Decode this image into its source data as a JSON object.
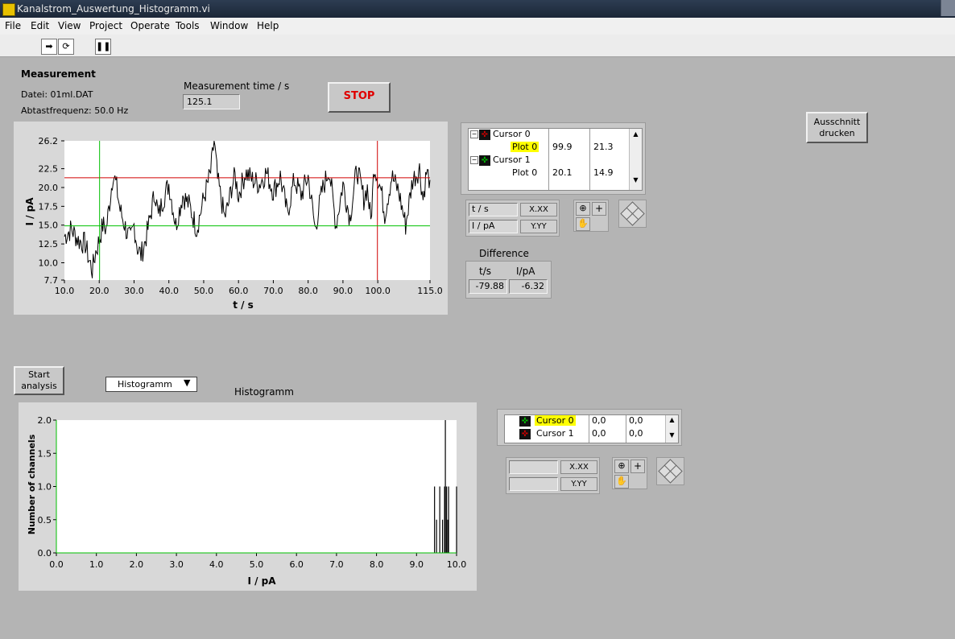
{
  "window": {
    "title": "Kanalstrom_Auswertung_Histogramm.vi"
  },
  "menu": [
    "File",
    "Edit",
    "View",
    "Project",
    "Operate",
    "Tools",
    "Window",
    "Help"
  ],
  "measurement": {
    "title": "Measurement",
    "file": "Datei: 01ml.DAT",
    "rate": "Abtastfrequenz: 50.0 Hz",
    "time_label": "Measurement time / s",
    "time_value": "125.1",
    "stop_label": "STOP"
  },
  "print_button": "Ausschnitt\ndrucken",
  "cursor_legend_top": {
    "rows": [
      {
        "name": "Cursor 0",
        "plot": "Plot 0",
        "x": "99.9",
        "y": "21.3",
        "color": "#d00000"
      },
      {
        "name": "Cursor 1",
        "plot": "Plot 0",
        "x": "20.1",
        "y": "14.9",
        "color": "#00a000"
      }
    ],
    "x_axis_label": "t / s",
    "y_axis_label": "I / pA",
    "x_format": "X.XX",
    "y_format": "Y.YY"
  },
  "difference": {
    "title": "Difference",
    "col_t": "t/s",
    "col_i": "I/pA",
    "t_value": "-79.88",
    "i_value": "-6.32"
  },
  "analysis": {
    "start_label": "Start\nanalysis",
    "mode": "Histogramm",
    "histogram_title": "Histogramm"
  },
  "cursor_legend_bottom": {
    "rows": [
      {
        "name": "Cursor 0",
        "x": "0,0",
        "y": "0,0",
        "color": "#00a000"
      },
      {
        "name": "Cursor 1",
        "x": "0,0",
        "y": "0,0",
        "color": "#d00000"
      }
    ],
    "x_format": "X.XX",
    "y_format": "Y.YY"
  },
  "chart_data": [
    {
      "type": "line",
      "xlabel": "t / s",
      "ylabel": "I / pA",
      "xlim": [
        10,
        115
      ],
      "ylim": [
        7.7,
        26.2
      ],
      "x_ticks": [
        "10.0",
        "20.0",
        "30.0",
        "40.0",
        "50.0",
        "60.0",
        "70.0",
        "80.0",
        "90.0",
        "100.0",
        "115.0"
      ],
      "y_ticks": [
        "26.2",
        "22.5",
        "20.0",
        "17.5",
        "15.0",
        "12.5",
        "10.0",
        "7.7"
      ],
      "grid": false,
      "cursors": [
        {
          "name": "Cursor 0",
          "x": 99.9,
          "y": 21.3,
          "color": "#d00000"
        },
        {
          "name": "Cursor 1",
          "x": 20.1,
          "y": 14.9,
          "color": "#00c000"
        }
      ],
      "series": [
        {
          "values_x": [
            10,
            12,
            14,
            16,
            17,
            18,
            19,
            20,
            21,
            22,
            23,
            24,
            25,
            26,
            27,
            28,
            29,
            30,
            31,
            32,
            33,
            34,
            35,
            36,
            37,
            38,
            40,
            42,
            44,
            46,
            48,
            50,
            52,
            53,
            54,
            55,
            56,
            57,
            58,
            59,
            60,
            62,
            64,
            66,
            68,
            70,
            72,
            74,
            76,
            78,
            80,
            82,
            84,
            86,
            88,
            90,
            92,
            94,
            96,
            97,
            98,
            99,
            100,
            101,
            102,
            104,
            106,
            108,
            110,
            112,
            113,
            114,
            115
          ],
          "values_y": [
            13.5,
            14.5,
            13.0,
            12.5,
            10.5,
            9.0,
            11.5,
            13.0,
            15.0,
            14.5,
            18.0,
            22.0,
            20.0,
            17.0,
            15.5,
            14.0,
            13.0,
            15.0,
            12.0,
            11.0,
            12.5,
            14.5,
            17.0,
            19.5,
            16.0,
            18.0,
            20.5,
            15.0,
            19.0,
            17.5,
            14.5,
            18.5,
            22.0,
            26.2,
            21.0,
            18.5,
            16.0,
            17.5,
            20.0,
            21.5,
            19.0,
            22.0,
            21.0,
            20.5,
            22.0,
            19.5,
            21.5,
            16.5,
            21.0,
            19.0,
            21.5,
            14.5,
            19.5,
            22.5,
            15.0,
            20.5,
            16.0,
            22.5,
            18.5,
            20.0,
            15.5,
            23.0,
            21.3,
            19.5,
            16.5,
            21.5,
            19.5,
            15.0,
            21.0,
            22.5,
            18.5,
            22.0,
            21.0
          ]
        }
      ]
    },
    {
      "type": "bar",
      "title": "Histogramm",
      "xlabel": "I / pA",
      "ylabel": "Number of channels",
      "xlim": [
        0,
        10
      ],
      "ylim": [
        0,
        2
      ],
      "x_ticks": [
        "0.0",
        "1.0",
        "2.0",
        "3.0",
        "4.0",
        "5.0",
        "6.0",
        "7.0",
        "8.0",
        "9.0",
        "10.0"
      ],
      "y_ticks": [
        "2.0",
        "1.5",
        "1.0",
        "0.5",
        "0.0"
      ],
      "x": [
        9.45,
        9.5,
        9.58,
        9.65,
        9.7,
        9.72,
        9.75,
        9.78,
        9.8,
        10.0
      ],
      "values": [
        1,
        0.5,
        1,
        0.5,
        1,
        2,
        1,
        0.5,
        1,
        1
      ]
    }
  ]
}
